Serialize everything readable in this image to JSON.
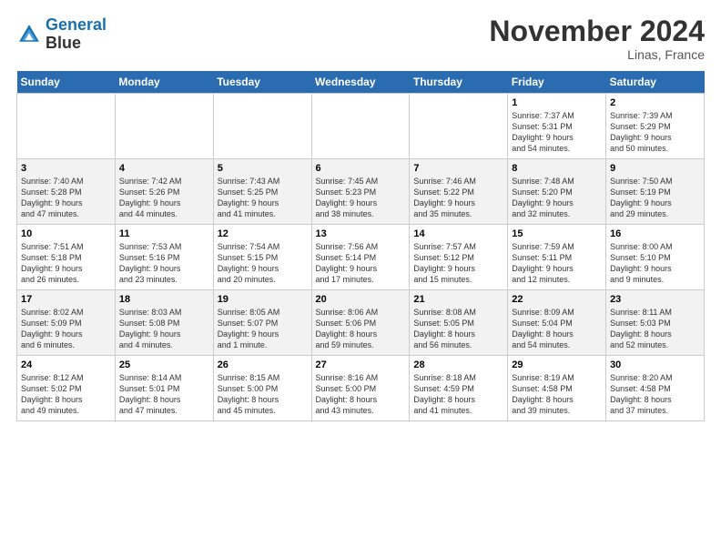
{
  "logo": {
    "text1": "General",
    "text2": "Blue"
  },
  "title": "November 2024",
  "location": "Linas, France",
  "columns": [
    "Sunday",
    "Monday",
    "Tuesday",
    "Wednesday",
    "Thursday",
    "Friday",
    "Saturday"
  ],
  "weeks": [
    [
      {
        "day": "",
        "info": ""
      },
      {
        "day": "",
        "info": ""
      },
      {
        "day": "",
        "info": ""
      },
      {
        "day": "",
        "info": ""
      },
      {
        "day": "",
        "info": ""
      },
      {
        "day": "1",
        "info": "Sunrise: 7:37 AM\nSunset: 5:31 PM\nDaylight: 9 hours\nand 54 minutes."
      },
      {
        "day": "2",
        "info": "Sunrise: 7:39 AM\nSunset: 5:29 PM\nDaylight: 9 hours\nand 50 minutes."
      }
    ],
    [
      {
        "day": "3",
        "info": "Sunrise: 7:40 AM\nSunset: 5:28 PM\nDaylight: 9 hours\nand 47 minutes."
      },
      {
        "day": "4",
        "info": "Sunrise: 7:42 AM\nSunset: 5:26 PM\nDaylight: 9 hours\nand 44 minutes."
      },
      {
        "day": "5",
        "info": "Sunrise: 7:43 AM\nSunset: 5:25 PM\nDaylight: 9 hours\nand 41 minutes."
      },
      {
        "day": "6",
        "info": "Sunrise: 7:45 AM\nSunset: 5:23 PM\nDaylight: 9 hours\nand 38 minutes."
      },
      {
        "day": "7",
        "info": "Sunrise: 7:46 AM\nSunset: 5:22 PM\nDaylight: 9 hours\nand 35 minutes."
      },
      {
        "day": "8",
        "info": "Sunrise: 7:48 AM\nSunset: 5:20 PM\nDaylight: 9 hours\nand 32 minutes."
      },
      {
        "day": "9",
        "info": "Sunrise: 7:50 AM\nSunset: 5:19 PM\nDaylight: 9 hours\nand 29 minutes."
      }
    ],
    [
      {
        "day": "10",
        "info": "Sunrise: 7:51 AM\nSunset: 5:18 PM\nDaylight: 9 hours\nand 26 minutes."
      },
      {
        "day": "11",
        "info": "Sunrise: 7:53 AM\nSunset: 5:16 PM\nDaylight: 9 hours\nand 23 minutes."
      },
      {
        "day": "12",
        "info": "Sunrise: 7:54 AM\nSunset: 5:15 PM\nDaylight: 9 hours\nand 20 minutes."
      },
      {
        "day": "13",
        "info": "Sunrise: 7:56 AM\nSunset: 5:14 PM\nDaylight: 9 hours\nand 17 minutes."
      },
      {
        "day": "14",
        "info": "Sunrise: 7:57 AM\nSunset: 5:12 PM\nDaylight: 9 hours\nand 15 minutes."
      },
      {
        "day": "15",
        "info": "Sunrise: 7:59 AM\nSunset: 5:11 PM\nDaylight: 9 hours\nand 12 minutes."
      },
      {
        "day": "16",
        "info": "Sunrise: 8:00 AM\nSunset: 5:10 PM\nDaylight: 9 hours\nand 9 minutes."
      }
    ],
    [
      {
        "day": "17",
        "info": "Sunrise: 8:02 AM\nSunset: 5:09 PM\nDaylight: 9 hours\nand 6 minutes."
      },
      {
        "day": "18",
        "info": "Sunrise: 8:03 AM\nSunset: 5:08 PM\nDaylight: 9 hours\nand 4 minutes."
      },
      {
        "day": "19",
        "info": "Sunrise: 8:05 AM\nSunset: 5:07 PM\nDaylight: 9 hours\nand 1 minute."
      },
      {
        "day": "20",
        "info": "Sunrise: 8:06 AM\nSunset: 5:06 PM\nDaylight: 8 hours\nand 59 minutes."
      },
      {
        "day": "21",
        "info": "Sunrise: 8:08 AM\nSunset: 5:05 PM\nDaylight: 8 hours\nand 56 minutes."
      },
      {
        "day": "22",
        "info": "Sunrise: 8:09 AM\nSunset: 5:04 PM\nDaylight: 8 hours\nand 54 minutes."
      },
      {
        "day": "23",
        "info": "Sunrise: 8:11 AM\nSunset: 5:03 PM\nDaylight: 8 hours\nand 52 minutes."
      }
    ],
    [
      {
        "day": "24",
        "info": "Sunrise: 8:12 AM\nSunset: 5:02 PM\nDaylight: 8 hours\nand 49 minutes."
      },
      {
        "day": "25",
        "info": "Sunrise: 8:14 AM\nSunset: 5:01 PM\nDaylight: 8 hours\nand 47 minutes."
      },
      {
        "day": "26",
        "info": "Sunrise: 8:15 AM\nSunset: 5:00 PM\nDaylight: 8 hours\nand 45 minutes."
      },
      {
        "day": "27",
        "info": "Sunrise: 8:16 AM\nSunset: 5:00 PM\nDaylight: 8 hours\nand 43 minutes."
      },
      {
        "day": "28",
        "info": "Sunrise: 8:18 AM\nSunset: 4:59 PM\nDaylight: 8 hours\nand 41 minutes."
      },
      {
        "day": "29",
        "info": "Sunrise: 8:19 AM\nSunset: 4:58 PM\nDaylight: 8 hours\nand 39 minutes."
      },
      {
        "day": "30",
        "info": "Sunrise: 8:20 AM\nSunset: 4:58 PM\nDaylight: 8 hours\nand 37 minutes."
      }
    ]
  ]
}
